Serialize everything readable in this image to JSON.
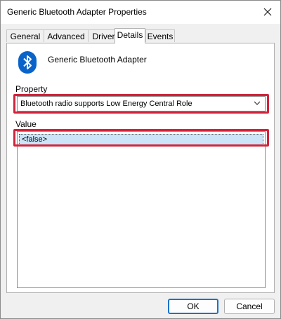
{
  "window": {
    "title": "Generic Bluetooth Adapter Properties"
  },
  "tabs": [
    {
      "label": "General",
      "active": false
    },
    {
      "label": "Advanced",
      "active": false
    },
    {
      "label": "Driver",
      "active": false
    },
    {
      "label": "Details",
      "active": true
    },
    {
      "label": "Events",
      "active": false
    }
  ],
  "device": {
    "name": "Generic Bluetooth Adapter",
    "icon": "bluetooth-icon",
    "icon_color": "#0a63c9"
  },
  "property": {
    "label": "Property",
    "selected": "Bluetooth radio supports Low Energy Central Role"
  },
  "value": {
    "label": "Value",
    "items": [
      "<false>"
    ]
  },
  "buttons": {
    "ok": "OK",
    "cancel": "Cancel"
  },
  "colors": {
    "highlight": "#d0243a",
    "selection": "#cce4f7",
    "accent": "#1a73c8"
  }
}
